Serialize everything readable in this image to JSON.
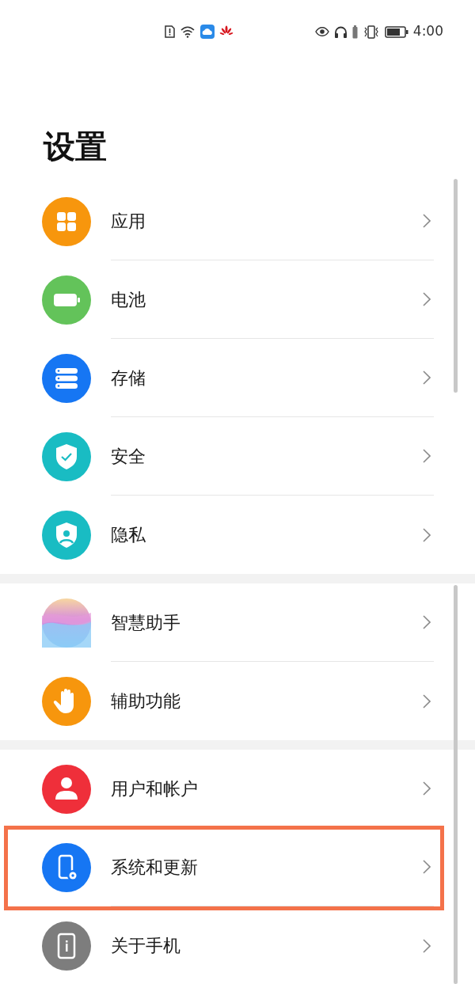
{
  "status_bar": {
    "time": "4:00"
  },
  "title": "设置",
  "groups": [
    {
      "items": [
        {
          "label": "应用",
          "kind": "apps",
          "color": "#f7960d",
          "highlighted": false
        },
        {
          "label": "电池",
          "kind": "battery",
          "color": "#63c35a",
          "highlighted": false
        },
        {
          "label": "存储",
          "kind": "storage",
          "color": "#1676f3",
          "highlighted": false
        },
        {
          "label": "安全",
          "kind": "shield",
          "color": "#19bcc3",
          "highlighted": false
        },
        {
          "label": "隐私",
          "kind": "privacy",
          "color": "#19bcc3",
          "highlighted": false
        }
      ]
    },
    {
      "items": [
        {
          "label": "智慧助手",
          "kind": "assistant",
          "highlighted": false
        },
        {
          "label": "辅助功能",
          "kind": "hand",
          "color": "#f7960d",
          "highlighted": false
        }
      ]
    },
    {
      "items": [
        {
          "label": "用户和帐户",
          "kind": "user",
          "color": "#ef2f3a",
          "highlighted": false
        },
        {
          "label": "系统和更新",
          "kind": "system",
          "color": "#1676f3",
          "highlighted": true
        },
        {
          "label": "关于手机",
          "kind": "about",
          "color": "#7d7d7d",
          "highlighted": false
        }
      ]
    }
  ]
}
